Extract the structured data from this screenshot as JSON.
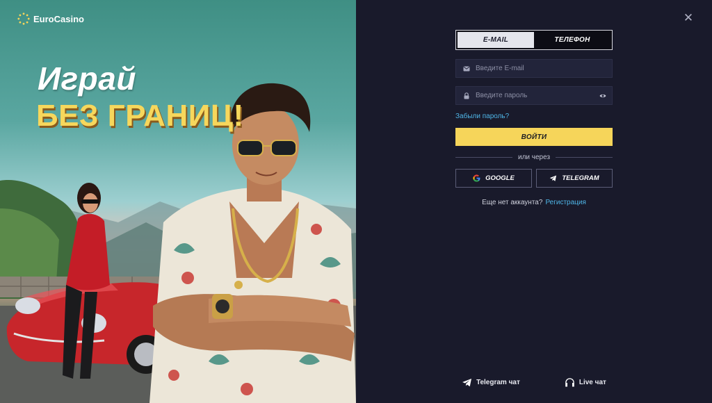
{
  "brand": {
    "name": "EuroCasino"
  },
  "promo": {
    "headline_line1": "Играй",
    "headline_line2": "БЕЗ ГРАНИЦ!"
  },
  "auth": {
    "tabs": [
      {
        "label": "E-MAIL",
        "active": true
      },
      {
        "label": "ТЕЛЕФОН",
        "active": false
      }
    ],
    "email_placeholder": "Введите E-mail",
    "password_placeholder": "Введите пароль",
    "forgot_password": "Забыли пароль?",
    "login_button": "ВОЙТИ",
    "divider_text": "или через",
    "social": [
      {
        "label": "GOOGLE",
        "icon": "google-icon"
      },
      {
        "label": "TELEGRAM",
        "icon": "telegram-icon"
      }
    ],
    "no_account_text": "Еще нет аккаунта?",
    "register_link": "Регистрация"
  },
  "footer": {
    "telegram_chat": "Telegram чат",
    "live_chat": "Live чат"
  },
  "colors": {
    "panel_bg": "#191a2b",
    "accent_yellow": "#f6d55a",
    "link_blue": "#4fb6e8"
  }
}
